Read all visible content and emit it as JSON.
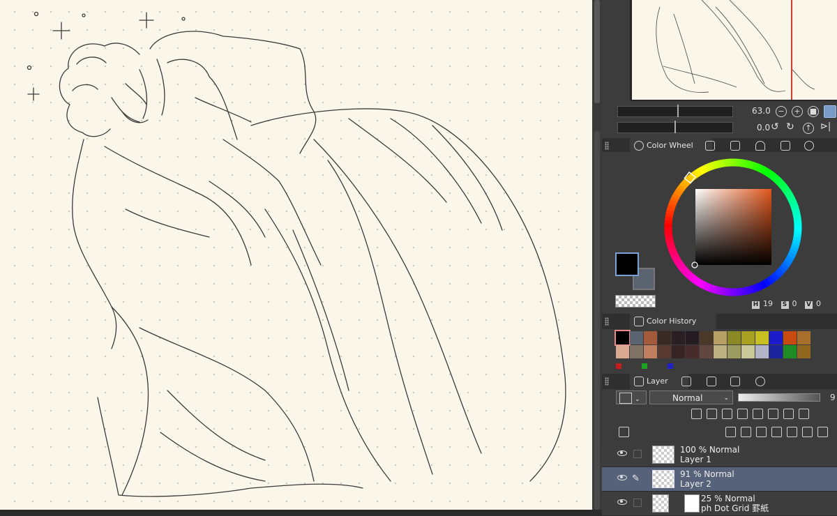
{
  "navigator": {
    "zoom_value": "63.0",
    "rotate_value": "0.0"
  },
  "color_wheel": {
    "tab_label": "Color Wheel",
    "h_label": "H",
    "h_value": "19",
    "s_label": "S",
    "s_value": "0",
    "v_label": "V",
    "v_value": "0",
    "main_color": "#000000",
    "sub_color": "#5a6470"
  },
  "color_history": {
    "tab_label": "Color History",
    "row1": [
      "#000000",
      "#5a6470",
      "#a55a3c",
      "#3a2a24",
      "#2a2024",
      "#241c20",
      "#4a3828",
      "#b8a064",
      "#8a8a24",
      "#a8a020",
      "#c8c020",
      "#1c1ccc",
      "#c84a10",
      "#a8702c"
    ],
    "row2": [
      "#d8a890",
      "#807264",
      "#c08060",
      "#5a3a30",
      "#382424",
      "#482c2c",
      "#604840",
      "#bcb080",
      "#9c9c60",
      "#c8c898",
      "#b4b4c8",
      "#1c24a0",
      "#208c28",
      "#906820"
    ],
    "mini": [
      "#c81c1c",
      "#20a020",
      "#2020c8"
    ]
  },
  "layers": {
    "tab_label": "Layer",
    "blend_mode": "Normal",
    "opacity_partial": "9",
    "items": [
      {
        "line1": "100 % Normal",
        "line2": "Layer 1"
      },
      {
        "line1": "91 % Normal",
        "line2": "Layer 2"
      },
      {
        "line1": "25 % Normal",
        "line2": "ph Dot Grid 罫紙"
      }
    ]
  }
}
